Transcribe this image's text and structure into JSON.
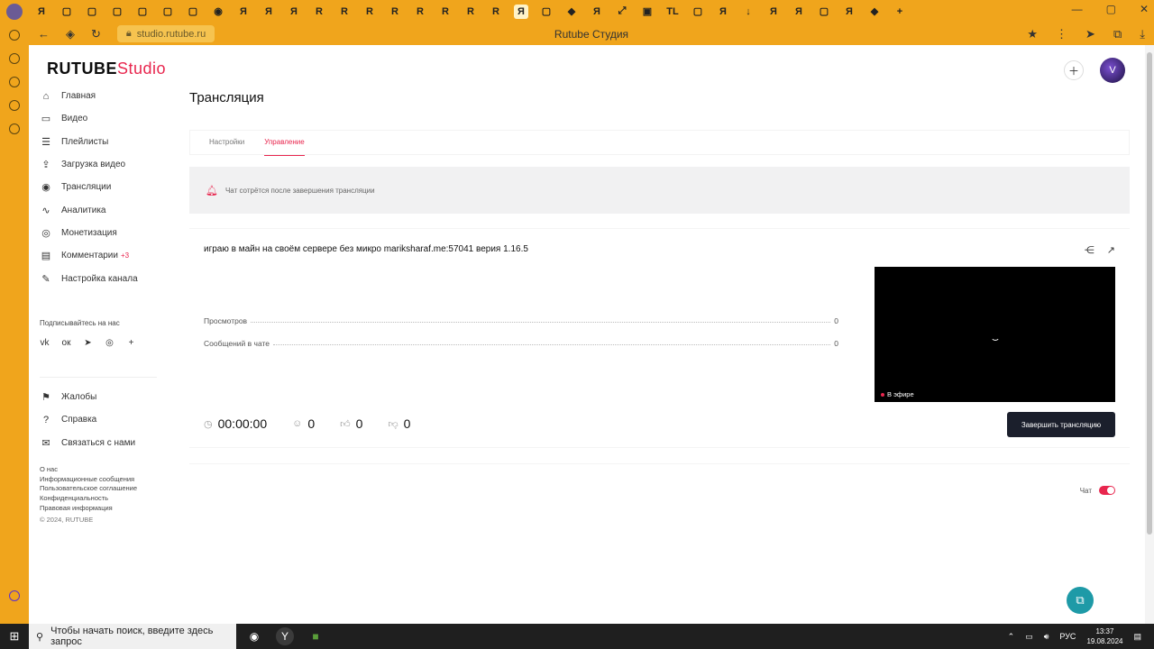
{
  "browser": {
    "url": "studio.rutube.ru",
    "window_title": "Rutube Студия",
    "tab_icons": [
      "Я",
      "▢",
      "▢",
      "▢",
      "▢",
      "▢",
      "▢",
      "◉",
      "Я",
      "Я",
      "Я",
      "R",
      "R",
      "R",
      "R",
      "R",
      "R",
      "R",
      "R",
      "Я",
      "▢",
      "◆",
      "Я",
      "⤢",
      "▣",
      "TL",
      "▢",
      "Я",
      "↓",
      "Я",
      "Я",
      "▢",
      "Я",
      "◆",
      "+"
    ]
  },
  "header": {
    "brand_main": "RUTUBE",
    "brand_sub": "Studio",
    "add_icon": "plus-square-icon",
    "avatar_letter": "V"
  },
  "sidebar": {
    "items": [
      {
        "label": "Главная",
        "icon": "⌂"
      },
      {
        "label": "Видео",
        "icon": "▭"
      },
      {
        "label": "Плейлисты",
        "icon": "☰"
      },
      {
        "label": "Загрузка видео",
        "icon": "⇪"
      },
      {
        "label": "Трансляции",
        "icon": "◉"
      },
      {
        "label": "Аналитика",
        "icon": "∿"
      },
      {
        "label": "Монетизация",
        "icon": "◎"
      },
      {
        "label": "Комментарии",
        "icon": "▤",
        "badge": "+3"
      },
      {
        "label": "Настройка канала",
        "icon": "✎"
      }
    ],
    "subscribe_label": "Подписывайтесь на нас",
    "socials": [
      "vk",
      "ок",
      "➤",
      "◎",
      "+"
    ],
    "secondary": [
      {
        "label": "Жалобы",
        "icon": "⚑"
      },
      {
        "label": "Справка",
        "icon": "?"
      },
      {
        "label": "Связаться с нами",
        "icon": "✉"
      }
    ],
    "footer": [
      "О нас",
      "Информационные сообщения",
      "Пользовательское соглашение",
      "Конфиденциальность",
      "Правовая информация"
    ],
    "copyright": "© 2024, RUTUBE"
  },
  "main": {
    "title": "Трансляция",
    "tabs": [
      {
        "label": "Настройки",
        "active": false
      },
      {
        "label": "Управление",
        "active": true
      }
    ],
    "notice": "Чат сотрётся после завершения трансляции",
    "stream": {
      "title": "играю в майн на своём сервере без микро mariksharaf.me:57041 верия 1.16.5",
      "stats": [
        {
          "label": "Просмотров",
          "value": "0"
        },
        {
          "label": "Сообщений в чате",
          "value": "0"
        }
      ],
      "timer": "00:00:00",
      "viewers": "0",
      "likes": "0",
      "dislikes": "0",
      "live_label": "В эфире",
      "end_button": "Завершить трансляцию"
    },
    "chat_label": "Чат",
    "chat_enabled": true
  },
  "taskbar": {
    "search_placeholder": "Чтобы начать поиск, введите здесь запрос",
    "lang": "РУС",
    "time": "13:37",
    "date": "19.08.2024"
  },
  "colors": {
    "accent": "#e8264e",
    "browser_chrome": "#f0a51c",
    "dark_button": "#1b1f2c"
  }
}
